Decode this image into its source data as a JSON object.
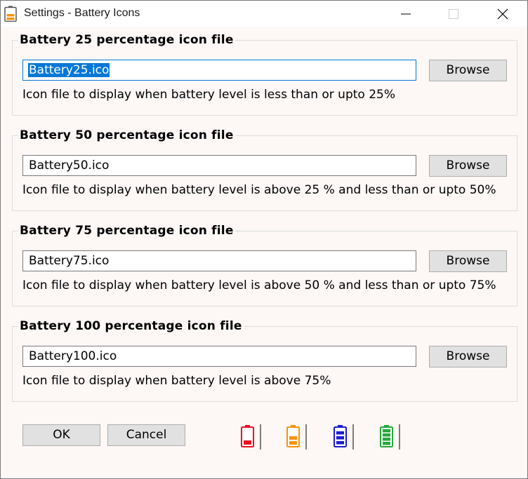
{
  "window": {
    "title": "Settings - Battery Icons"
  },
  "groups": [
    {
      "title": "Battery 25 percentage icon file",
      "value": "Battery25.ico",
      "browse": "Browse",
      "description": "Icon file to display when battery level is less than or upto 25%"
    },
    {
      "title": "Battery 50 percentage icon file",
      "value": "Battery50.ico",
      "browse": "Browse",
      "description": "Icon file to display when battery level is above 25 % and less than or upto 50%"
    },
    {
      "title": "Battery 75 percentage icon file",
      "value": "Battery75.ico",
      "browse": "Browse",
      "description": "Icon file to display when battery level is above 50 % and less than or upto 75%"
    },
    {
      "title": "Battery 100 percentage icon file",
      "value": "Battery100.ico",
      "browse": "Browse",
      "description": "Icon file to display when battery level is above 75%"
    }
  ],
  "buttons": {
    "ok": "OK",
    "cancel": "Cancel"
  },
  "battery_icons": [
    {
      "name": "battery-25-icon",
      "color": "#e81123"
    },
    {
      "name": "battery-50-icon",
      "color": "#f7930e"
    },
    {
      "name": "battery-75-icon",
      "color": "#1b1bd1"
    },
    {
      "name": "battery-100-icon",
      "color": "#23a838"
    }
  ]
}
